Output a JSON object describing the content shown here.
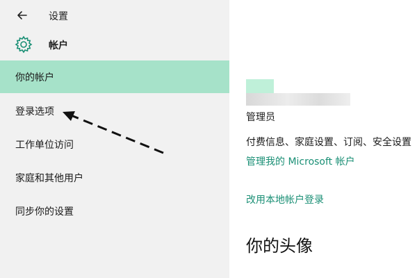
{
  "window": {
    "title": "设置"
  },
  "section": {
    "title": "帐户",
    "icon": "gear-icon"
  },
  "nav": {
    "items": [
      {
        "label": "你的帐户",
        "active": true
      },
      {
        "label": "登录选项",
        "active": false
      },
      {
        "label": "工作单位访问",
        "active": false
      },
      {
        "label": "家庭和其他用户",
        "active": false
      },
      {
        "label": "同步你的设置",
        "active": false
      }
    ]
  },
  "main": {
    "role": "管理员",
    "services": "付费信息、家庭设置、订阅、安全设置",
    "manage_link": "管理我的 Microsoft 帐户",
    "local_link": "改用本地帐户登录",
    "avatar_heading": "你的头像"
  },
  "colors": {
    "accent": "#1a8f75",
    "active_nav": "#a6e2c9",
    "sidebar_bg": "#f1f1f1"
  }
}
